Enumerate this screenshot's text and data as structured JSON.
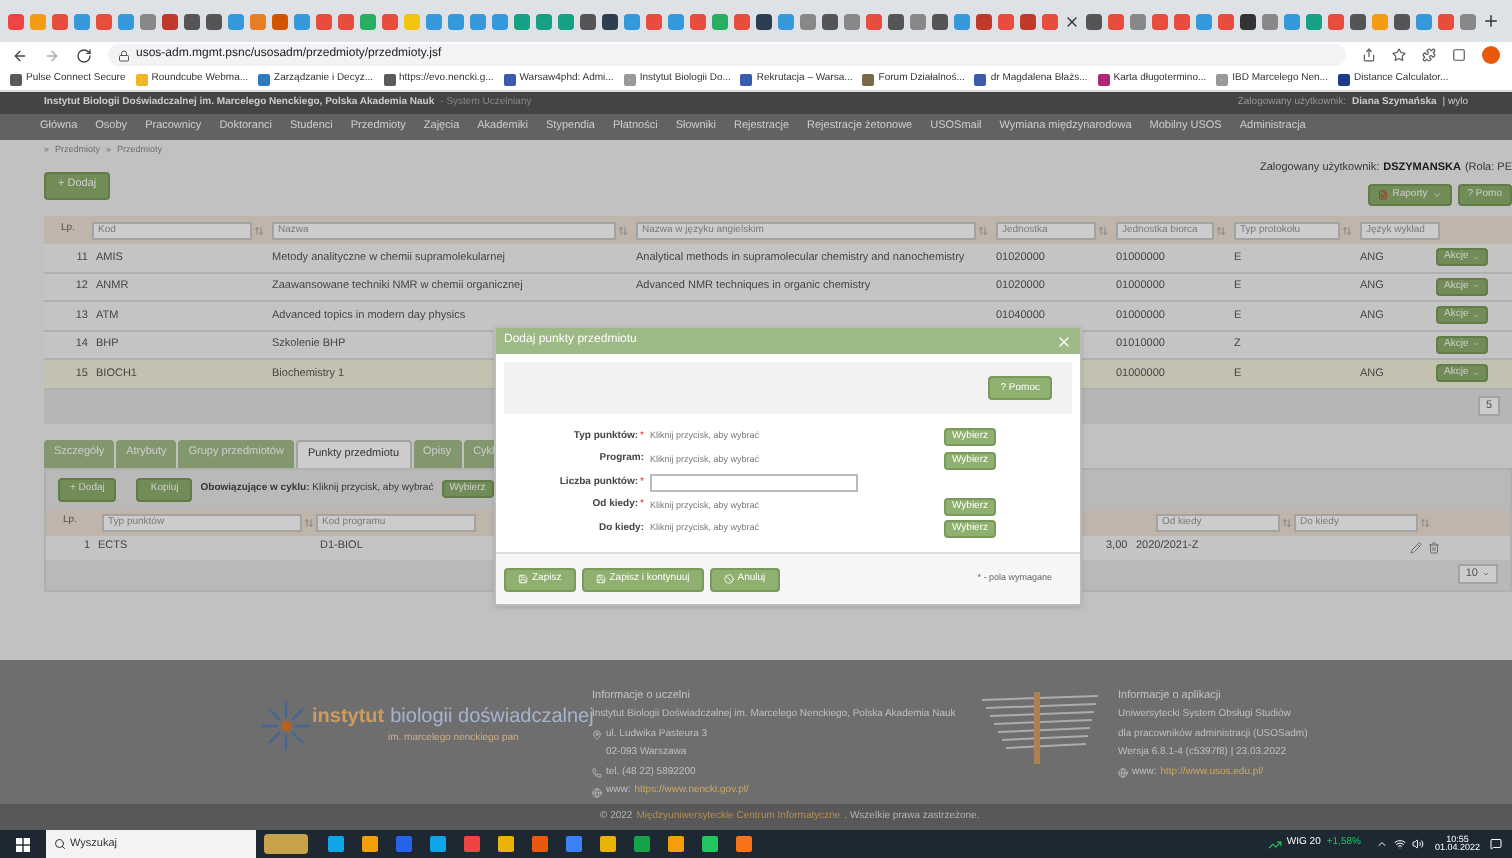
{
  "browser": {
    "url": "usos-adm.mgmt.psnc/usosadm/przedmioty/przedmioty.jsf",
    "bookmarks": [
      {
        "label": "Pulse Connect Secure",
        "color": "#5a5a5a"
      },
      {
        "label": "Roundcube Webma...",
        "color": "#f0b429"
      },
      {
        "label": "Zarządzanie i Decyz...",
        "color": "#2f7bbf"
      },
      {
        "label": "https://evo.nencki.g...",
        "color": "#5a5a5a"
      },
      {
        "label": "Warsaw4phd: Admi...",
        "color": "#3b5bab"
      },
      {
        "label": "Instytut Biologii Do...",
        "color": "#9a9a9a"
      },
      {
        "label": "Rekrutacja – Warsa...",
        "color": "#3b5bab"
      },
      {
        "label": "Forum Działalnoś...",
        "color": "#7a6a4a"
      },
      {
        "label": "dr Magdalena Błażs...",
        "color": "#3b5bab"
      },
      {
        "label": "Karta długotermino...",
        "color": "#b0287a"
      },
      {
        "label": "IBD Marcelego Nen...",
        "color": "#9a9a9a"
      },
      {
        "label": "Distance Calculator...",
        "color": "#1a3a8a"
      }
    ]
  },
  "header": {
    "institution": "Instytut Biologii Doświadczalnej im. Marcelego Nenckiego, Polska Akademia Nauk",
    "system": "- System Uczelniany",
    "user_label": "Zalogowany użytkownik:",
    "user_name": "Diana Szymańska",
    "logout": "| wylo"
  },
  "menu": [
    "Główna",
    "Osoby",
    "Pracownicy",
    "Doktoranci",
    "Studenci",
    "Przedmioty",
    "Zajęcia",
    "Akademiki",
    "Stypendia",
    "Płatności",
    "Słowniki",
    "Rejestracje",
    "Rejestracje żetonowe",
    "USOSmail",
    "Wymiana międzynarodowa",
    "Mobilny USOS",
    "Administracja"
  ],
  "breadcrumb": {
    "separator": "»",
    "items": [
      "Przedmioty",
      "Przedmioty"
    ]
  },
  "add_button": "+ Dodaj",
  "session": {
    "label": "Zalogowany użytkownik:",
    "user": "DSZYMANSKA",
    "role": "(Rola: PE"
  },
  "toolbar": {
    "reports": "Raporty",
    "help": "? Pomo"
  },
  "table": {
    "lp_label": "Lp.",
    "filters": [
      {
        "placeholder": "Kod"
      },
      {
        "placeholder": "Nazwa"
      },
      {
        "placeholder": "Nazwa w języku angielskim"
      },
      {
        "placeholder": "Jednostka"
      },
      {
        "placeholder": "Jednostka biorca"
      },
      {
        "placeholder": "Typ protokołu"
      },
      {
        "placeholder": "Język wykład"
      }
    ],
    "rows": [
      {
        "lp": "11",
        "kod": "AMIS",
        "nazwa": "Metody analityczne w chemii supramolekularnej",
        "nazwa_en": "Analytical methods in supramolecular chemistry and nanochemistry",
        "jednostka": "01020000",
        "biorca": "01000000",
        "typ": "E",
        "jezyk": "ANG",
        "action": "Akcje",
        "selected": false
      },
      {
        "lp": "12",
        "kod": "ANMR",
        "nazwa": "Zaawansowane techniki NMR w chemii organicznej",
        "nazwa_en": "Advanced NMR techniques in organic chemistry",
        "jednostka": "01020000",
        "biorca": "01000000",
        "typ": "E",
        "jezyk": "ANG",
        "action": "Akcje",
        "selected": false
      },
      {
        "lp": "13",
        "kod": "ATM",
        "nazwa": "Advanced topics in modern day physics",
        "jednostka": "01040000",
        "biorca": "01000000",
        "typ": "E",
        "jezyk": "ANG",
        "action": "Akcje",
        "selected": false
      },
      {
        "lp": "14",
        "kod": "BHP",
        "nazwa": "Szkolenie BHP",
        "biorca": "01010000",
        "typ": "Z",
        "action": "Akcje",
        "selected": false
      },
      {
        "lp": "15",
        "kod": "BIOCH1",
        "nazwa": "Biochemistry 1",
        "biorca": "01000000",
        "typ": "E",
        "jezyk": "ANG",
        "action": "Akcje",
        "selected": true
      }
    ],
    "page": "5"
  },
  "detail_tabs": [
    {
      "label": "Szczegóły",
      "selected": false
    },
    {
      "label": "Atrybuty",
      "selected": false
    },
    {
      "label": "Grupy przedmiotów",
      "selected": false
    },
    {
      "label": "Punkty przedmiotu",
      "selected": true
    },
    {
      "label": "Opisy",
      "selected": false
    },
    {
      "label": "Cykl",
      "selected": false
    }
  ],
  "points": {
    "add": "+ Dodaj",
    "copy": "Kopiuj",
    "cycle": "**Obowiązujące w cyklu:** Kliknij przycisk, aby wybrać",
    "choose": "Wybierz",
    "lp_label": "Lp.",
    "filters": [
      {
        "placeholder": "Typ punktów"
      },
      {
        "placeholder": "Kod programu"
      },
      {
        "placeholder": "Od kiedy"
      },
      {
        "placeholder": "Do kiedy"
      }
    ],
    "rows": [
      {
        "lp": "1",
        "typ": "ECTS",
        "kod": "D1-BIOL",
        "liczba": "3,00",
        "od": "2020/2021-Z"
      }
    ],
    "page_size": "10"
  },
  "modal": {
    "title": "Dodaj punkty przedmiotu",
    "help": "? Pomoc",
    "fields": [
      {
        "kind": "choice",
        "label": "Typ punktów:",
        "mark": "*",
        "hint": "Kliknij przycisk, aby wybrać",
        "button": "Wybierz"
      },
      {
        "kind": "choice",
        "label": "Program:",
        "hint": "Kliknij przycisk, aby wybrać",
        "button": "Wybierz"
      },
      {
        "kind": "input",
        "label": "Liczba punktów:",
        "mark": "*"
      },
      {
        "kind": "choice",
        "label": "Od kiedy:",
        "mark": "*",
        "hint": "Kliknij przycisk, aby wybrać",
        "button": "Wybierz"
      },
      {
        "kind": "choice",
        "label": "Do kiedy:",
        "hint": "Kliknij przycisk, aby wybrać",
        "button": "Wybierz"
      }
    ],
    "buttons": [
      {
        "kind": "save",
        "label": "Zapisz"
      },
      {
        "kind": "save",
        "label": "Zapisz i kontynuuj"
      },
      {
        "kind": "cancel",
        "label": "Anuluj"
      }
    ],
    "required_note": "* - pola wymagane"
  },
  "footer": {
    "logo_word1": "instytut",
    "logo_word2": "biologii doświadczalnej",
    "logo_sub": "im. marcelego nenckiego pan",
    "uni_title": "Informacje o uczelni",
    "uni_name": "Instytut Biologii Doświadczalnej im. Marcelego Nenckiego, Polska Akademia Nauk",
    "address1": "ul. Ludwika Pasteura 3",
    "address2": "02-093 Warszawa",
    "phone": "tel. (48 22) 5892200",
    "uni_www_label": "www:",
    "uni_url": "https://www.nencki.gov.pl/",
    "app_title": "Informacje o aplikacji",
    "app_name1": "Uniwersytecki System Obsługi Studiów",
    "app_name2": "dla pracowników administracji (USOSadm)",
    "version": "Wersja 6.8.1-4 (c5397f8) | 23.03.2022",
    "app_www_label": "www:",
    "app_url": "http://www.usos.edu.pl/",
    "copyright_prefix": "© 2022",
    "copyright_link": "Międzyuniwersyteckie Centrum Informatyczne",
    "copyright_suffix": ". Wszelkie prawa zastrzeżone."
  },
  "taskbar": {
    "search_placeholder": "Wyszukaj",
    "stock": "WIG 20",
    "change": "+1,58%",
    "time": "10:55",
    "date": "01.04.2022"
  }
}
